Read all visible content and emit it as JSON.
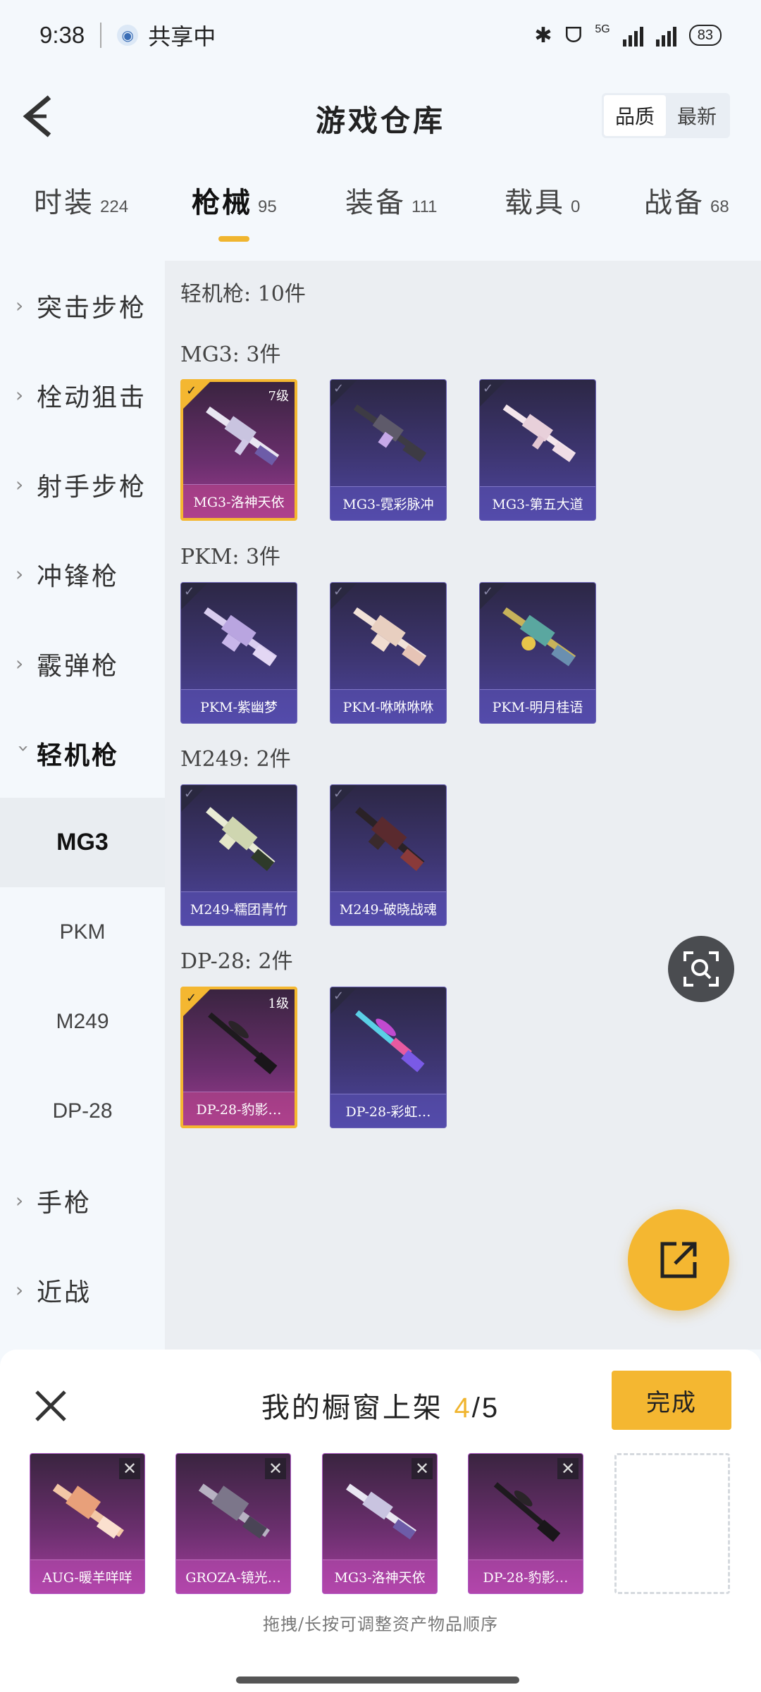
{
  "status_bar": {
    "time": "9:38",
    "sharing": "共享中",
    "network": "5G",
    "battery": "83"
  },
  "header": {
    "title": "游戏仓库",
    "sort_quality": "品质",
    "sort_newest": "最新"
  },
  "tabs": [
    {
      "label": "时装",
      "count": "224"
    },
    {
      "label": "枪械",
      "count": "95"
    },
    {
      "label": "装备",
      "count": "111"
    },
    {
      "label": "载具",
      "count": "0"
    },
    {
      "label": "战备",
      "count": "68"
    }
  ],
  "sidebar": {
    "categories": [
      {
        "label": "突击步枪"
      },
      {
        "label": "栓动狙击"
      },
      {
        "label": "射手步枪"
      },
      {
        "label": "冲锋枪"
      },
      {
        "label": "霰弹枪"
      },
      {
        "label": "轻机枪"
      },
      {
        "label": "手枪"
      },
      {
        "label": "近战"
      }
    ],
    "subcategories": [
      "MG3",
      "PKM",
      "M249",
      "DP-28"
    ]
  },
  "main": {
    "summary": "轻机枪: 10件",
    "groups": [
      {
        "title": "MG3: 3件",
        "items": [
          {
            "name": "MG3-洛神天依",
            "level": "7级",
            "selected": true
          },
          {
            "name": "MG3-霓彩脉冲",
            "selected": false
          },
          {
            "name": "MG3-第五大道",
            "selected": false
          }
        ]
      },
      {
        "title": "PKM: 3件",
        "items": [
          {
            "name": "PKM-紫幽梦",
            "selected": false
          },
          {
            "name": "PKM-咻咻咻咻",
            "selected": false
          },
          {
            "name": "PKM-明月桂语",
            "selected": false
          }
        ]
      },
      {
        "title": "M249: 2件",
        "items": [
          {
            "name": "M249-糯团青竹",
            "selected": false
          },
          {
            "name": "M249-破晓战魂",
            "selected": false
          }
        ]
      },
      {
        "title": "DP-28: 2件",
        "items": [
          {
            "name": "DP-28-豹影…",
            "level": "1级",
            "selected": true
          },
          {
            "name": "DP-28-彩虹…",
            "selected": false
          }
        ]
      }
    ]
  },
  "sheet": {
    "title": "我的橱窗上架",
    "current": "4",
    "total": "/5",
    "done_label": "完成",
    "slots": [
      {
        "name": "AUG-暖羊咩咩"
      },
      {
        "name": "GROZA-镜光…"
      },
      {
        "name": "MG3-洛神天依"
      },
      {
        "name": "DP-28-豹影…"
      }
    ],
    "hint": "拖拽/长按可调整资产物品顺序"
  },
  "colors": {
    "accent": "#f4b731",
    "card_normal": "#3e3673",
    "card_selected": "#6b2f6e"
  }
}
